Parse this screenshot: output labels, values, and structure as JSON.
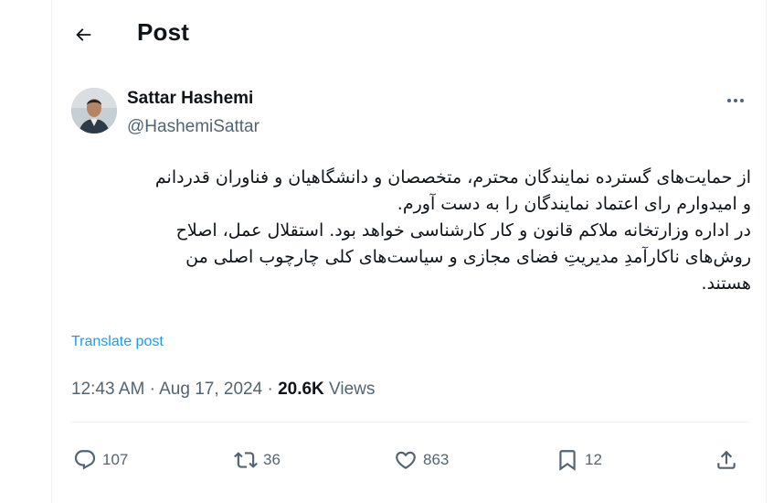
{
  "header": {
    "title": "Post",
    "back_icon": "arrow-left-icon"
  },
  "author": {
    "name": "Sattar Hashemi",
    "handle": "@HashemiSattar"
  },
  "more_icon": "more-horizontal-icon",
  "tweet": {
    "text": "از حمایت‌های گسترده نمایندگان محترم، متخصصان و دانشگاهیان و فناوران قدردانم\nو امیدوارم رای اعتماد نمایندگان را به دست آورم.\nدر اداره وزارتخانه ملاکم قانون و کار کارشناسی خواهد بود. استقلال عمل، اصلاح\nروش‌های ناکارآمدِ مدیریتِ فضای مجازی و سیاست‌های کلی چارچوب اصلی من\nهستند."
  },
  "translate_label": "Translate post",
  "meta": {
    "time": "12:43 AM",
    "separator": "·",
    "date": "Aug 17, 2024",
    "views_count": "20.6K",
    "views_label": "Views"
  },
  "actions": {
    "replies": "107",
    "reposts": "36",
    "likes": "863",
    "bookmarks": "12"
  },
  "colors": {
    "accent": "#1d9bf0",
    "secondary_text": "#536471",
    "primary_text": "#0f1419"
  }
}
